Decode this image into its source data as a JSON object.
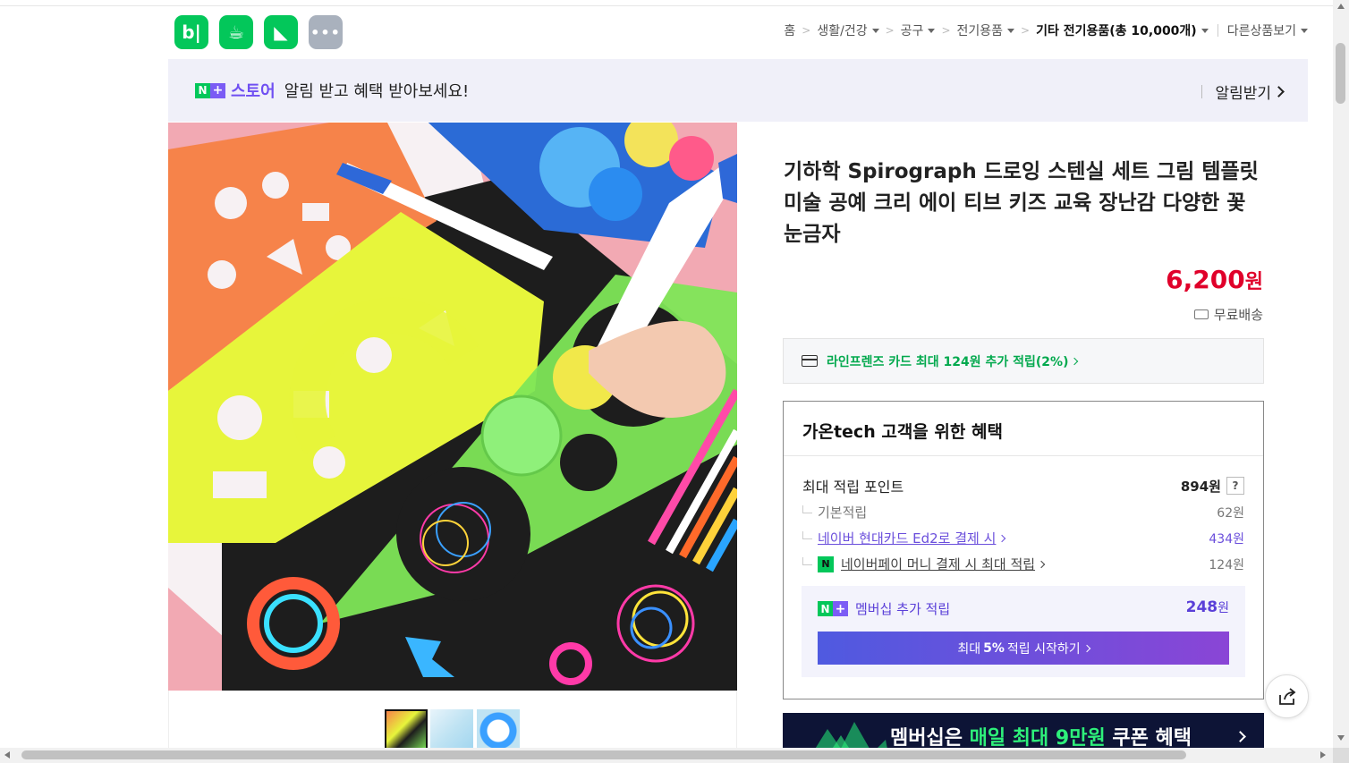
{
  "apps": [
    {
      "name": "blog-app",
      "glyph": "b|",
      "icon": "blog-icon"
    },
    {
      "name": "cafe-app",
      "glyph": "☕",
      "icon": "cafe-icon"
    },
    {
      "name": "bookmark-app",
      "glyph": "◣",
      "icon": "bookmark-icon"
    },
    {
      "name": "more-app",
      "glyph": "•••",
      "icon": "more-icon"
    }
  ],
  "breadcrumb": {
    "home": "홈",
    "cat1": "생활/건강",
    "cat2": "공구",
    "cat3": "전기용품",
    "cat4": "기타 전기용품",
    "cat4_count": "(총 10,000개)",
    "other": "다른상품보기"
  },
  "banner": {
    "n": "N",
    "plus": "+",
    "store": "스토어",
    "text": "알림 받고 혜택 받아보세요!",
    "action": "알림받기"
  },
  "product": {
    "title": "기하학 Spirograph 드로잉 스텐실 세트 그림 템플릿 미술 공예 크리 에이 티브 키즈 교육 장난감 다양한 꽃 눈금자",
    "price": "6,200",
    "price_unit": "원",
    "shipping": "무료배송"
  },
  "card_offer": {
    "text": "라인프렌즈 카드 최대 124원 추가 적립(2%)"
  },
  "benefits": {
    "title": "가온tech 고객을 위한 혜택",
    "max_points_label": "최대 적립 포인트",
    "max_points_value": "894원",
    "help": "?",
    "basic_label": "기본적립",
    "basic_value": "62원",
    "hyundai_label": "네이버 현대카드 Ed2로 결제 시",
    "hyundai_value": "434원",
    "npay_badge": "N",
    "npay_label": "네이버페이 머니 결제 시 최대 적립",
    "npay_value": "124원",
    "membership_label": "멤버십 추가 적립",
    "membership_value": "248",
    "membership_unit": "원",
    "membership_btn_pre": "최대",
    "membership_btn_bold": "5%",
    "membership_btn_post": "적립 시작하기"
  },
  "promo": {
    "pre": "멤버십은",
    "highlight": "매일 최대 9만원",
    "post": "쿠폰 혜택"
  },
  "colors": {
    "naver_green": "#03c75a",
    "price_red": "#e0002a",
    "purple": "#6b4fdc"
  }
}
